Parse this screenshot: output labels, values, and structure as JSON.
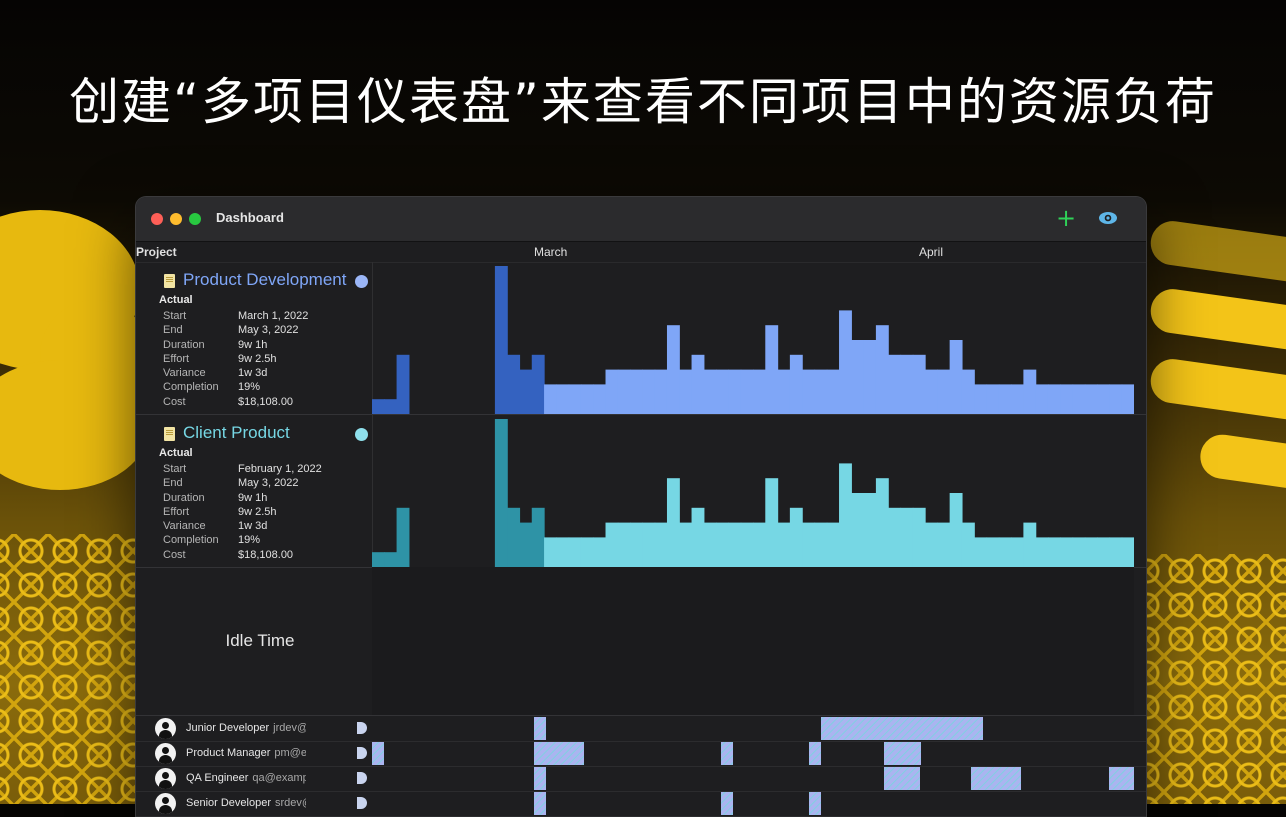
{
  "headline": "创建“多项目仪表盘”来查看不同项目中的资源负荷",
  "window": {
    "title": "Dashboard",
    "add_icon": "+",
    "eye_icon": "eye-icon"
  },
  "timeline": {
    "column_label": "Project",
    "months": [
      "March",
      "April"
    ]
  },
  "stat_labels": [
    "Start",
    "End",
    "Duration",
    "Effort",
    "Variance",
    "Completion",
    "Cost"
  ],
  "projects": [
    {
      "name": "Product Development",
      "color": "#7fa6f7",
      "dark_color": "#3462c0",
      "section": "Actual",
      "stats": [
        "March 1, 2022",
        "May 3, 2022",
        "9w 1h",
        "9w 2.5h",
        "1w 3d",
        "19%",
        "$18,108.00"
      ]
    },
    {
      "name": "Client Product",
      "color": "#76d7e4",
      "dark_color": "#2e93a6",
      "section": "Actual",
      "stats": [
        "February 1, 2022",
        "May 3, 2022",
        "9w 1h",
        "9w 2.5h",
        "1w 3d",
        "19%",
        "$18,108.00"
      ]
    }
  ],
  "idle": {
    "label": "Idle Time"
  },
  "resources": [
    {
      "name": "Junior Developer",
      "email": "jrdev@example"
    },
    {
      "name": "Product Manager",
      "email": "pm@example.c"
    },
    {
      "name": "QA Engineer",
      "email": "qa@example.org"
    },
    {
      "name": "Senior Developer",
      "email": "srdev@example"
    }
  ],
  "chart_data": {
    "type": "bar",
    "note_units": "relative load",
    "levels": [
      1,
      1,
      4,
      2,
      2,
      2,
      2,
      2,
      2,
      2,
      10,
      4,
      3,
      4,
      2,
      2,
      2,
      2,
      2,
      3,
      3,
      3,
      3,
      3,
      6,
      3,
      4,
      3,
      3,
      3,
      3,
      3,
      6,
      3,
      4,
      3,
      3,
      3,
      7,
      5,
      5,
      6,
      4,
      4,
      4,
      3,
      3,
      5,
      3,
      2,
      2,
      2,
      2,
      3,
      2,
      2,
      2,
      2,
      2,
      2,
      2,
      2
    ],
    "dark_until_index": 14,
    "gap_indices": [
      3,
      4,
      5,
      6,
      7,
      8,
      9
    ]
  }
}
